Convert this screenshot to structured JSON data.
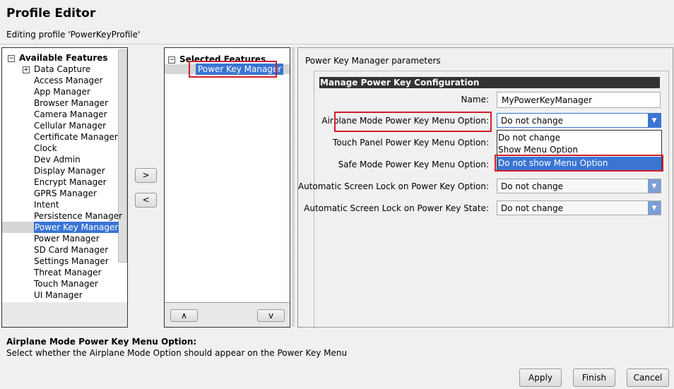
{
  "header": {
    "title": "Profile Editor",
    "subtitle": "Editing profile 'PowerKeyProfile'"
  },
  "available": {
    "title": "Available Features",
    "items": [
      "Data Capture",
      "Access Manager",
      "App Manager",
      "Browser Manager",
      "Camera Manager",
      "Cellular Manager",
      "Certificate Manager",
      "Clock",
      "Dev Admin",
      "Display Manager",
      "Encrypt Manager",
      "GPRS Manager",
      "Intent",
      "Persistence Manager",
      "Power Key Manager",
      "Power Manager",
      "SD Card Manager",
      "Settings Manager",
      "Threat Manager",
      "Touch Manager",
      "UI Manager"
    ],
    "selected_item": "Power Key Manager"
  },
  "transfer": {
    "add": ">",
    "remove": "<"
  },
  "selected": {
    "title": "Selected Features",
    "items": [
      "Power Key Manager"
    ],
    "up": "∧",
    "down": "v"
  },
  "params": {
    "panel_title": "Power Key Manager parameters",
    "section": "Manage Power Key Configuration",
    "name_label": "Name:",
    "name_value": "MyPowerKeyManager",
    "rows": [
      {
        "label": "Airplane Mode Power Key Menu Option:",
        "value": "Do not change"
      },
      {
        "label": "Touch Panel Power Key Menu Option:",
        "value": "Do not change"
      },
      {
        "label": "Safe Mode Power Key Menu Option:",
        "value": "Do not change"
      },
      {
        "label": "Automatic Screen Lock on Power Key Option:",
        "value": "Do not change"
      },
      {
        "label": "Automatic Screen Lock on Power Key State:",
        "value": "Do not change"
      }
    ],
    "dropdown_options": [
      "Do not change",
      "Show Menu Option",
      "Do not show Menu Option"
    ],
    "highlighted_option": "Do not show Menu Option"
  },
  "help": {
    "title": "Airplane Mode Power Key Menu Option:",
    "text": "Select whether the Airplane Mode Option should appear on the Power Key Menu"
  },
  "footer": {
    "apply": "Apply",
    "finish": "Finish",
    "cancel": "Cancel"
  },
  "colors": {
    "highlight": "#3a75d4",
    "annotation": "#d0202a",
    "section_bar": "#333333"
  }
}
